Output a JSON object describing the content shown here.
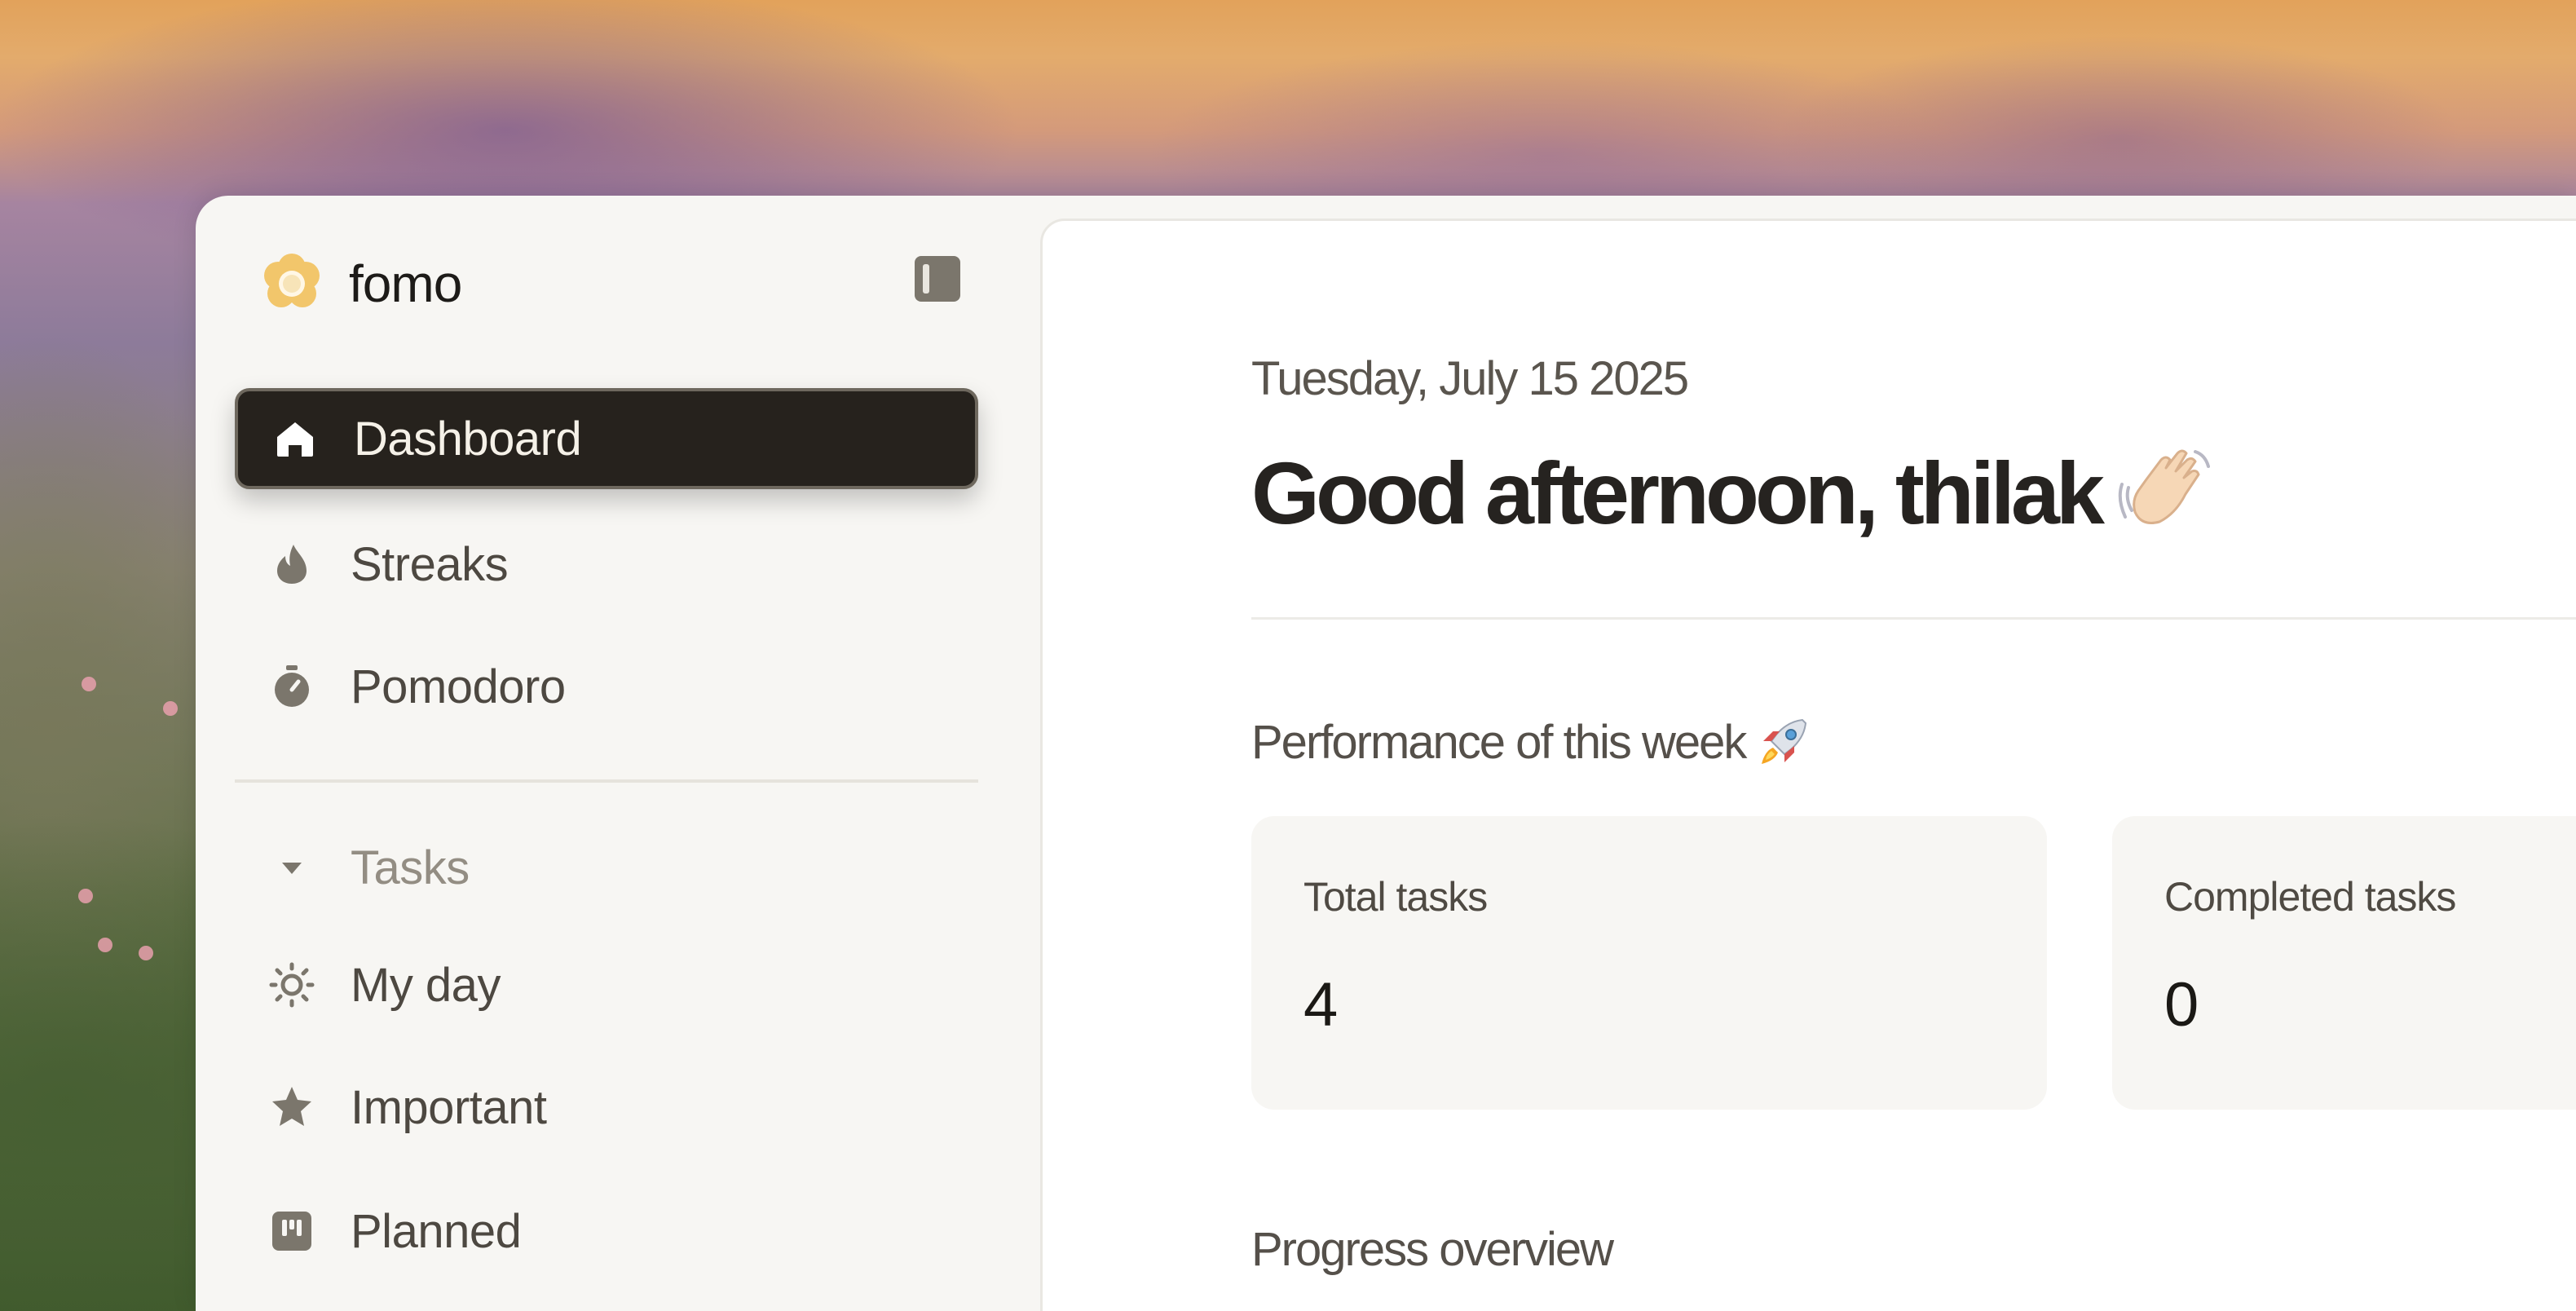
{
  "app": {
    "name": "fomo",
    "logo_icon": "flower-logo-icon",
    "collapse_icon": "sidebar-toggle-icon"
  },
  "sidebar": {
    "primary_items": [
      {
        "label": "Dashboard",
        "icon": "home-icon",
        "active": true
      },
      {
        "label": "Streaks",
        "icon": "flame-icon",
        "active": false
      },
      {
        "label": "Pomodoro",
        "icon": "stopwatch-icon",
        "active": false
      }
    ],
    "tasks_section": {
      "label": "Tasks",
      "icon": "caret-down-icon",
      "items": [
        {
          "label": "My day",
          "icon": "sun-icon"
        },
        {
          "label": "Important",
          "icon": "star-icon"
        },
        {
          "label": "Planned",
          "icon": "calendar-board-icon"
        }
      ]
    }
  },
  "main": {
    "date": "Tuesday, July 15 2025",
    "greeting": "Good afternoon, thilak",
    "greeting_emoji": "waving-hand-icon",
    "performance_title": "Performance of this week",
    "performance_emoji": "rocket-icon",
    "stats": [
      {
        "label": "Total tasks",
        "value": "4"
      },
      {
        "label": "Completed tasks",
        "value": "0"
      }
    ],
    "progress_title": "Progress overview"
  },
  "colors": {
    "active_nav_bg": "#26221d",
    "sidebar_bg": "#f7f6f3",
    "main_bg": "#ffffff",
    "card_bg": "#f7f6f3",
    "icon_color": "#7b766c"
  }
}
